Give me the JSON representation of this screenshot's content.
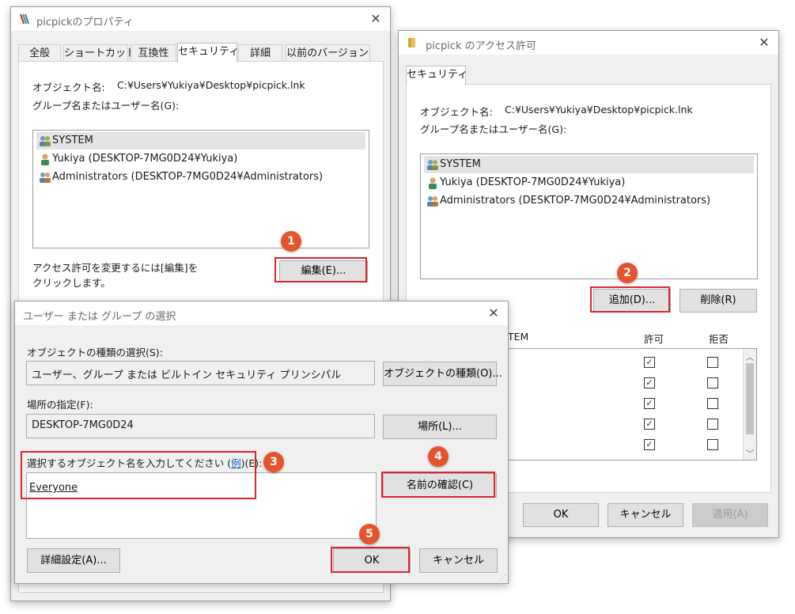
{
  "props": {
    "title": "picpickのプロパティ",
    "tabs": [
      "全般",
      "ショートカット",
      "互換性",
      "セキュリティ",
      "詳細",
      "以前のバージョン"
    ],
    "object_label": "オブジェクト名:",
    "object_value": "C:¥Users¥Yukiya¥Desktop¥picpick.lnk",
    "group_label": "グループ名またはユーザー名(G):",
    "users": [
      "SYSTEM",
      "Yukiya (DESKTOP-7MG0D24¥Yukiya)",
      "Administrators (DESKTOP-7MG0D24¥Administrators)"
    ],
    "change_note_1": "アクセス許可を変更するには[編集]を",
    "change_note_2": "クリックします。",
    "edit_button": "編集(E)..."
  },
  "access": {
    "title": "picpick のアクセス許可",
    "tab": "セキュリティ",
    "object_label": "オブジェクト名:",
    "object_value": "C:¥Users¥Yukiya¥Desktop¥picpick.lnk",
    "group_label": "グループ名またはユーザー名(G):",
    "users": [
      "SYSTEM",
      "Yukiya (DESKTOP-7MG0D24¥Yukiya)",
      "Administrators (DESKTOP-7MG0D24¥Administrators)"
    ],
    "add_button": "追加(D)...",
    "remove_button": "削除(R)",
    "perm_header_fragment": "STEM",
    "allow_header": "許可",
    "deny_header": "拒否",
    "allow_checked": [
      true,
      true,
      true,
      true,
      true
    ],
    "ok_button": "OK",
    "cancel_button": "キャンセル",
    "apply_button": "適用(A)"
  },
  "select": {
    "title": "ユーザー または グループ の選択",
    "obj_type_label": "オブジェクトの種類の選択(S):",
    "obj_type_value": "ユーザー、グループ または ビルトイン セキュリティ プリンシパル",
    "obj_type_button": "オブジェクトの種類(O)...",
    "location_label": "場所の指定(F):",
    "location_value": "DESKTOP-7MG0D24",
    "location_button": "場所(L)...",
    "enter_label_pre": "選択するオブジェクト名を入力してください (",
    "enter_label_link": "例",
    "enter_label_post": ")(E):",
    "entered_name": "Everyone",
    "check_names_button": "名前の確認(C)",
    "advanced_button": "詳細設定(A)...",
    "ok_button": "OK",
    "cancel_button": "キャンセル"
  },
  "steps": [
    "1",
    "2",
    "3",
    "4",
    "5"
  ],
  "colors": {
    "highlight": "#d9262f",
    "marker": "#e5542c"
  }
}
